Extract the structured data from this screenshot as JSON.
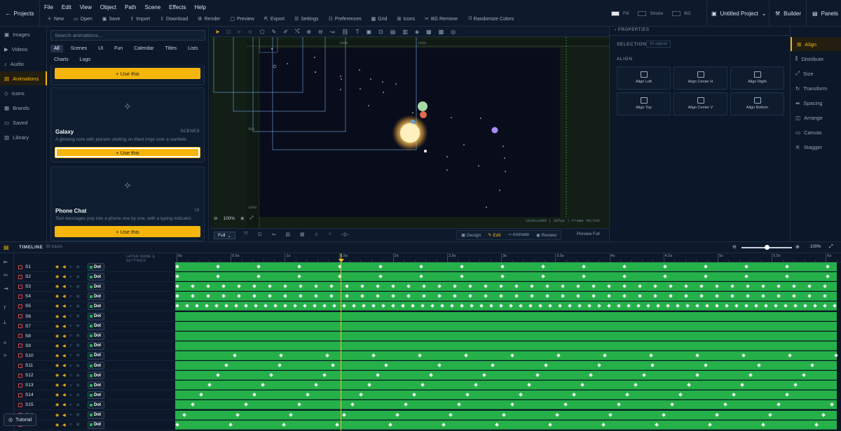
{
  "menubar": {
    "projects": "Projects",
    "menus": [
      "File",
      "Edit",
      "View",
      "Object",
      "Path",
      "Scene",
      "Effects",
      "Help"
    ],
    "tools": [
      "New",
      "Open",
      "Save",
      "Import",
      "Download",
      "Render",
      "Preview",
      "Export",
      "Settings",
      "Preferences",
      "Grid",
      "Icons",
      "BG Remove",
      "Randomize Colors"
    ],
    "fill": "Fill",
    "stroke": "Stroke",
    "bg": "BG",
    "project": "Untitled Project",
    "builder": "Builder",
    "panels": "Panels"
  },
  "nav": [
    "Images",
    "Videos",
    "Audio",
    "Animations",
    "Icons",
    "Brands",
    "Saved",
    "Library"
  ],
  "library": {
    "search_placeholder": "Search animations...",
    "chips": [
      "All",
      "Scenes",
      "UI",
      "Fun",
      "Calendar",
      "Titles",
      "Lists",
      "Charts",
      "Logo"
    ],
    "use": "+ Use this",
    "cards": [
      {
        "title": "Galaxy",
        "cat": "SCENES",
        "desc": "A glowing core with planets orbiting on tilted rings over a starfield."
      },
      {
        "title": "Phone Chat",
        "cat": "UI",
        "desc": "Text messages pop into a phone one by one, with a typing indicator."
      }
    ]
  },
  "canvas": {
    "ruler_h": [
      "1000",
      "1500"
    ],
    "ruler_v": [
      "500",
      "1000"
    ],
    "zoom": "100%",
    "info": "1920x1080 | 30fps | Frame 46/240"
  },
  "bottom": {
    "full": "Full",
    "design": "Design",
    "edit": "Edit",
    "animate": "Animate",
    "review": "Review",
    "preview": "Preview Full"
  },
  "props": {
    "title": "PROPERTIES",
    "selection": "SELECTION",
    "sel_count": "16 objects",
    "align": "ALIGN",
    "buttons": [
      "Align Left",
      "Align Center H",
      "Align Right",
      "Align Top",
      "Align Center V",
      "Align Bottom"
    ]
  },
  "tabs": [
    "Align",
    "Distribute",
    "Size",
    "Transform",
    "Spacing",
    "Arrange",
    "Canvas",
    "Stagger"
  ],
  "timeline": {
    "title": "TIMELINE",
    "tracks": "36 tracks",
    "zoom": "100%",
    "header": "LAYER NAME & SETTINGS",
    "ruler": [
      "0s",
      "0.5s",
      "1s",
      "1.5s",
      "2s",
      "2.5s",
      "3s",
      "3.5s",
      "4s",
      "4.5s",
      "5s",
      "5.5s",
      "6s"
    ],
    "rows": [
      "S1",
      "S2",
      "S3",
      "S4",
      "S5",
      "S6",
      "S7",
      "S8",
      "S9",
      "S10",
      "S11",
      "S12",
      "S13",
      "S14",
      "S15",
      "S16",
      "S17"
    ],
    "dot": "Dot",
    "tutorial": "Tutorial"
  }
}
